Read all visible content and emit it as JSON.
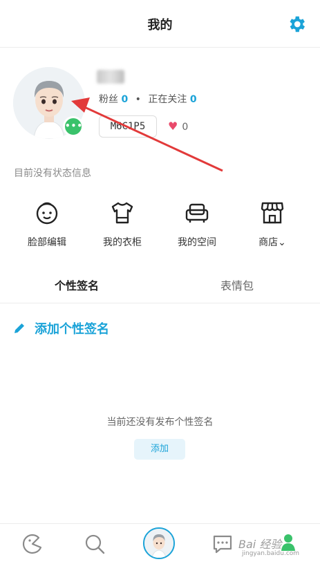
{
  "header": {
    "title": "我的",
    "settings_icon": "gear-icon"
  },
  "profile": {
    "avatar_icon": "avatar-3d",
    "more_badge": "•••",
    "stats": {
      "fans_label": "粉丝",
      "fans_count": "0",
      "following_label": "正在关注",
      "following_count": "0",
      "separator": "•"
    },
    "id_code": "M6C1P5",
    "likes_count": "0"
  },
  "status": {
    "text": "目前没有状态信息"
  },
  "shortcuts": [
    {
      "label": "脸部编辑",
      "icon": "face-icon"
    },
    {
      "label": "我的衣柜",
      "icon": "shirt-icon"
    },
    {
      "label": "我的空间",
      "icon": "sofa-icon"
    },
    {
      "label": "商店",
      "icon": "store-icon",
      "suffix": "⌄"
    }
  ],
  "tabs": [
    {
      "label": "个性签名",
      "active": true
    },
    {
      "label": "表情包",
      "active": false
    }
  ],
  "signature": {
    "add_label": "添加个性签名",
    "empty_text": "当前还没有发布个性签名",
    "add_button": "添加"
  },
  "bottom_nav": {
    "items": [
      "home-icon",
      "search-icon",
      "avatar-icon",
      "chat-icon",
      "friends-icon"
    ],
    "watermark": "Bai 经验",
    "watermark_sub": "jingyan.baidu.com"
  },
  "colors": {
    "accent": "#1ba3d8",
    "green": "#3ac26b",
    "heart": "#e94a6b",
    "arrow": "#e23a3a"
  }
}
